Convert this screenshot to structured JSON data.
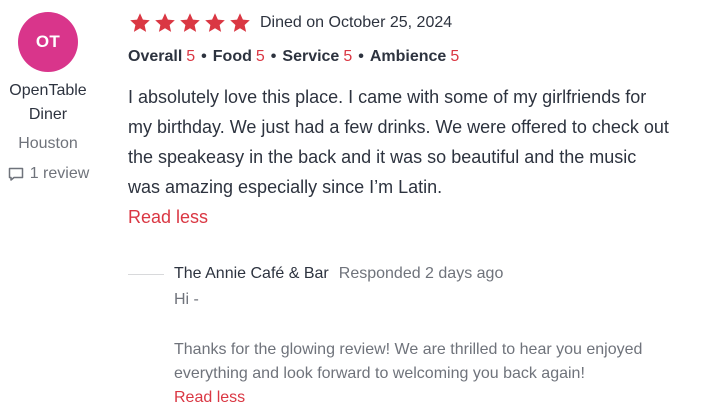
{
  "reviewer": {
    "initials": "OT",
    "avatar_color": "#d9358b",
    "name": "OpenTable Diner",
    "city": "Houston",
    "review_count": "1 review",
    "review_count_icon": "comment-icon"
  },
  "review": {
    "stars": 5,
    "star_color": "#da3743",
    "star_icon": "star-icon",
    "dined": "Dined on October 25, 2024",
    "ratings": [
      {
        "label": "Overall",
        "value": "5"
      },
      {
        "label": "Food",
        "value": "5"
      },
      {
        "label": "Service",
        "value": "5"
      },
      {
        "label": "Ambience",
        "value": "5"
      }
    ],
    "text": "I absolutely love this place. I came with some of my girlfriends for my birthday. We just had a few drinks. We were offered to check out the speakeasy in the back and it was so beautiful and the music was amazing especially since I’m Latin.",
    "read_less": "Read less"
  },
  "response": {
    "restaurant": "The Annie Café & Bar",
    "when": "Responded 2 days ago",
    "greeting": "Hi -",
    "text": "Thanks for the glowing review! We are thrilled to hear you enjoyed everything and look forward to welcoming you back again!",
    "read_less": "Read less"
  },
  "colors": {
    "accent": "#da3743",
    "text": "#2d333f",
    "muted": "#6f737b"
  }
}
